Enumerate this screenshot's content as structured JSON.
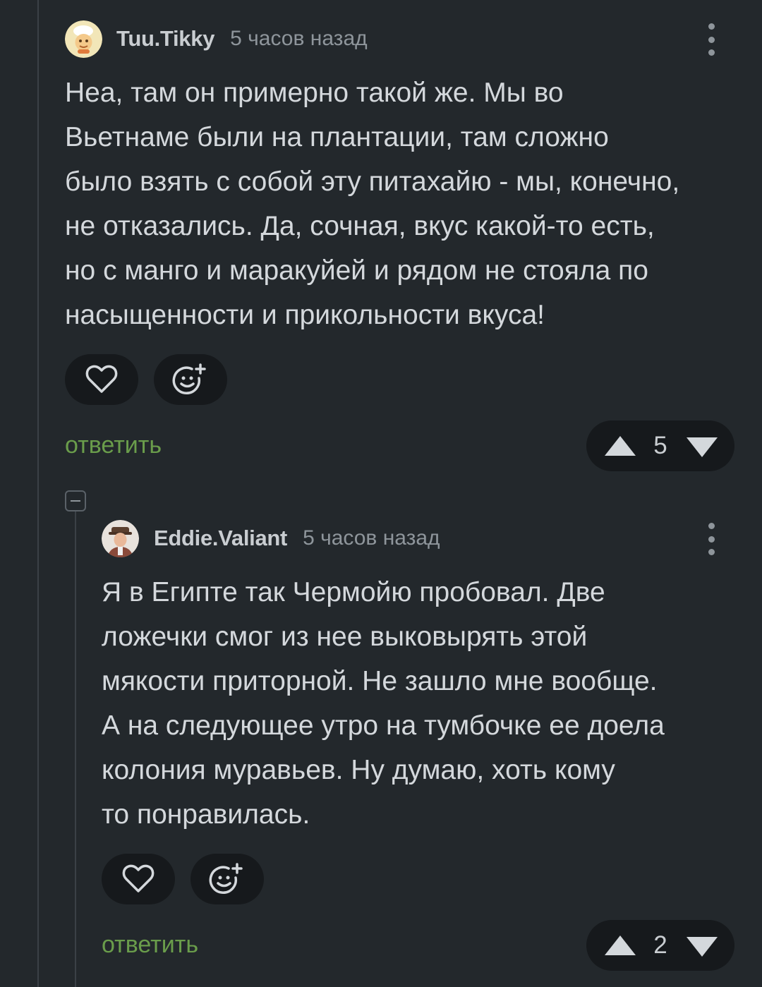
{
  "comments": [
    {
      "username": "Tuu.Tikky",
      "timestamp": "5 часов назад",
      "avatar_icon": "avatar-cartoon-face",
      "body": "Неа, там он примерно такой же. Мы во\nВьетнаме были на плантации, там сложно\nбыло взять с собой эту питахайю - мы, конечно,\nне отказались. Да, сочная, вкус какой-то есть,\nно с манго и маракуйей и рядом не стояла по\nнасыщенности и прикольности вкуса!",
      "reply_label": "ответить",
      "score": "5"
    },
    {
      "username": "Eddie.Valiant",
      "timestamp": "5 часов назад",
      "avatar_icon": "avatar-man-in-hat",
      "body": "Я в Египте так Чермойю пробовал. Две\nложечки смог из нее выковырять этой\nмякости приторной. Не зашло мне вообще.\nА на следующее утро на тумбочке ее доела\nколония муравьев. Ну думаю, хоть кому\nто понравилась.",
      "reply_label": "ответить",
      "score": "2"
    }
  ],
  "colors": {
    "background": "#23282c",
    "reply_accent": "#6a9d4b",
    "pill_background": "#16191c"
  },
  "icons": {
    "like": "heart-icon",
    "reaction": "smiley-plus-icon",
    "upvote": "triangle-up-icon",
    "downvote": "triangle-down-icon",
    "more": "vertical-dots-icon",
    "collapse": "minus-square-icon"
  }
}
